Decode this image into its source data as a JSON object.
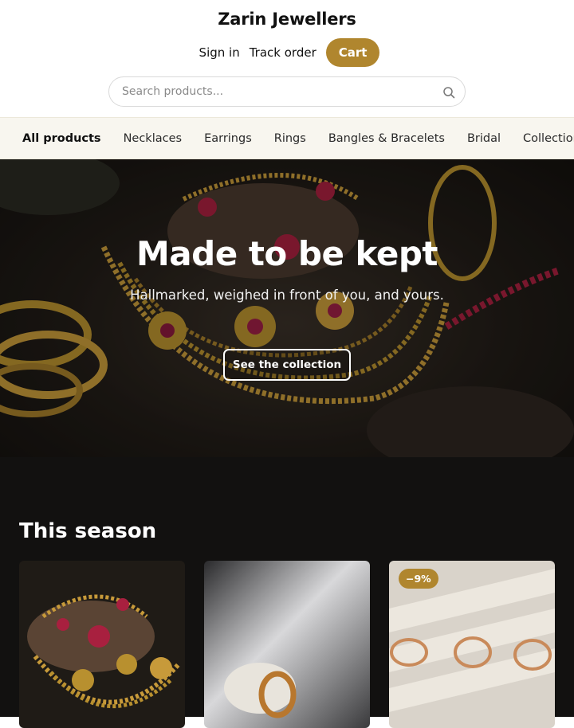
{
  "header": {
    "brand": "Zarin Jewellers",
    "links": [
      "Sign in",
      "Track order"
    ],
    "cart_label": "Cart",
    "search_placeholder": "Search products..."
  },
  "categories": [
    "All products",
    "Necklaces",
    "Earrings",
    "Rings",
    "Bangles & Bracelets",
    "Bridal",
    "Collections"
  ],
  "hero": {
    "title": "Made to be kept",
    "subtitle": "Hallmarked, weighed in front of you, and yours.",
    "cta_label": "See the collection"
  },
  "season": {
    "title": "This season",
    "products": [
      {
        "badge": ""
      },
      {
        "badge": ""
      },
      {
        "badge": "−9%"
      }
    ]
  },
  "colors": {
    "accent": "#b0862e",
    "category_bar_bg": "#f8f6ef",
    "section_bg": "#121110"
  },
  "icons": {
    "search": "search-icon"
  }
}
